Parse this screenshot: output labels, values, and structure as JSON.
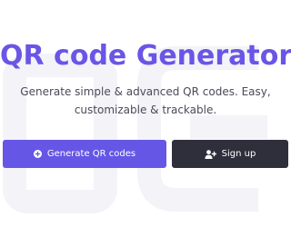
{
  "hero": {
    "title": "QR code Generator",
    "subtitle": "Generate simple & advanced QR codes. Easy, customizable & trackable."
  },
  "buttons": {
    "generate_label": "Generate QR codes",
    "generate_icon": "plus-circle-icon",
    "signup_label": "Sign up",
    "signup_icon": "user-plus-icon"
  },
  "colors": {
    "brand": "#6a55e6",
    "primary_button": "#6656e6",
    "dark_button": "#2f2f3c",
    "subtitle_text": "#4a4a5a",
    "watermark": "#f3f3f8"
  }
}
